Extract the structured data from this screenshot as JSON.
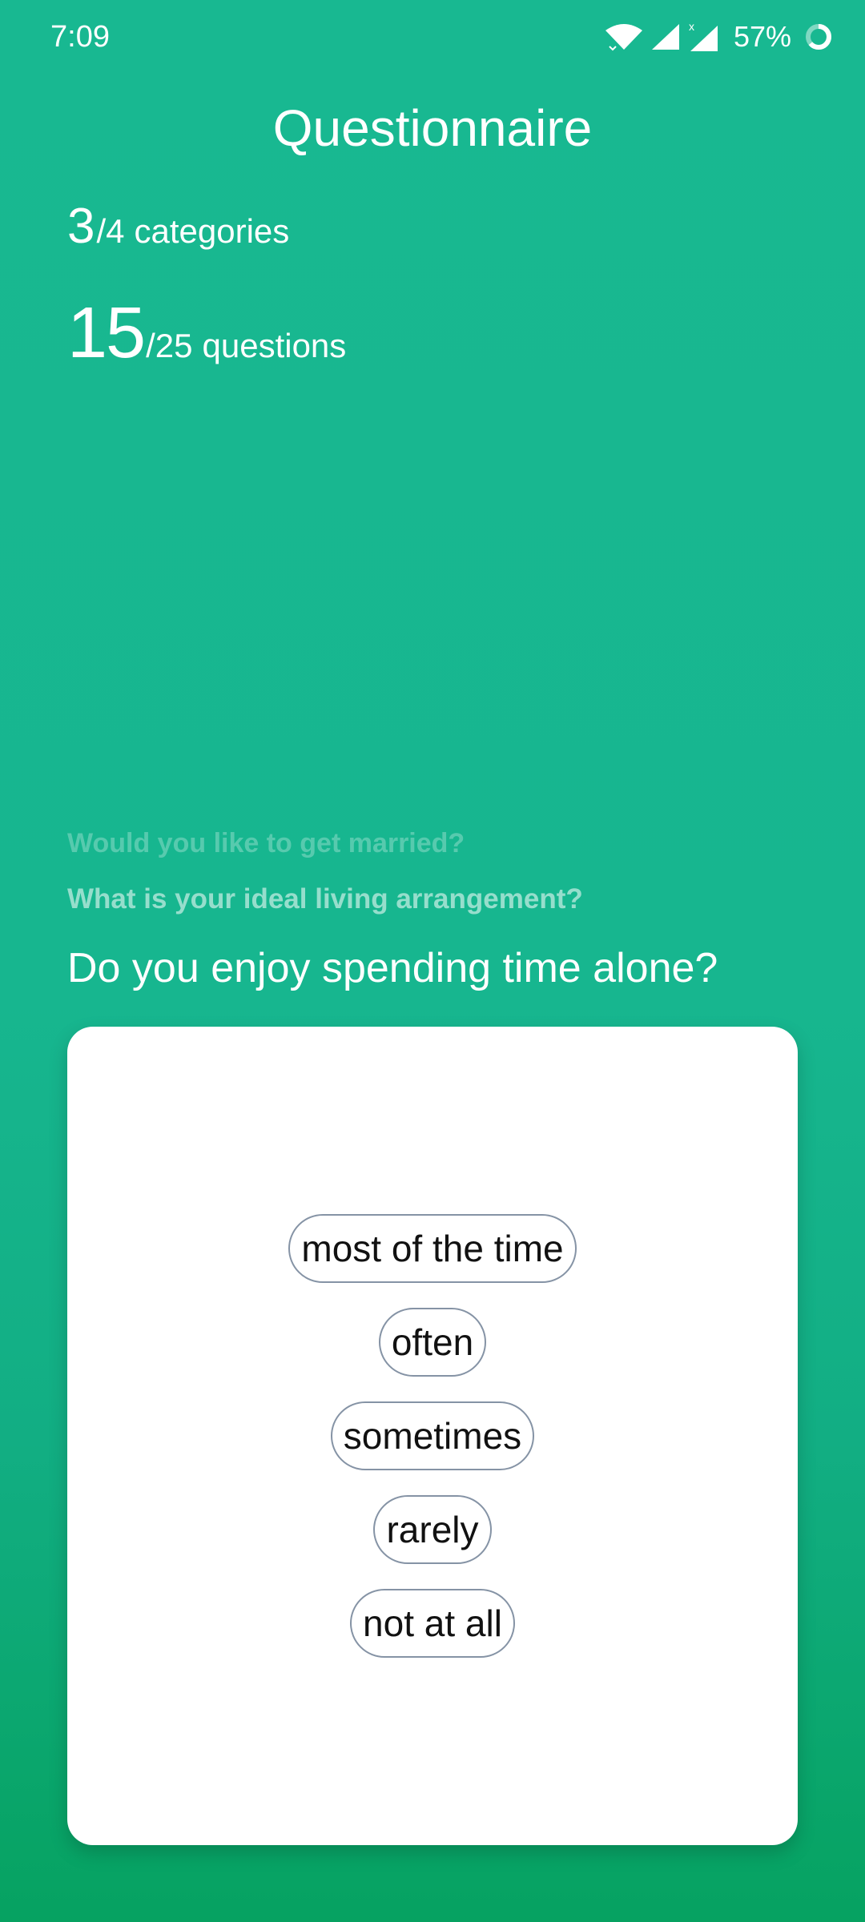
{
  "status_bar": {
    "time": "7:09",
    "battery": "57%",
    "icons": [
      "wifi-icon",
      "cell-signal-icon",
      "cell-signal-no-data-icon",
      "battery-ring-icon"
    ]
  },
  "header": {
    "title": "Questionnaire"
  },
  "progress": {
    "categories_current": "3",
    "categories_total": "/4",
    "categories_label": "categories",
    "categories_fraction": 0.75,
    "questions_current": "15",
    "questions_total": "/25",
    "questions_label": "questions",
    "questions_fraction": 0.6
  },
  "previous_questions": [
    "Would you like to get married?",
    "What is your ideal living arrangement?"
  ],
  "current_question": "Do you enjoy spending time alone?",
  "answers": [
    "most of the time",
    "often",
    "sometimes",
    "rarely",
    "not at all"
  ],
  "colors": {
    "background_top": "#18b891",
    "background_bottom": "#06a261",
    "card": "#ffffff",
    "option_border": "#8593a5",
    "option_text": "#111111"
  }
}
